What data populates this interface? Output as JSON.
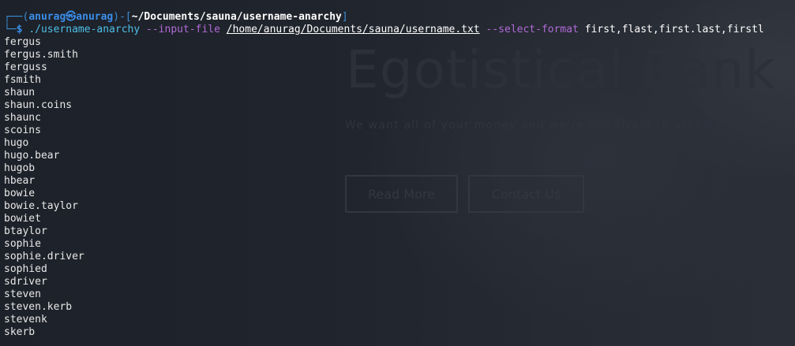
{
  "background": {
    "title": "Egotistical Bank",
    "subtitle": "We want all of your money and we're not afraid to ask!",
    "read_more": "Read More",
    "contact_us": "Contact Us"
  },
  "prompt": {
    "frame_top": "┌──(",
    "user": "anurag",
    "at_symbol": "㉿",
    "host": "anurag",
    "frame_mid": ")-[",
    "path": "~/Documents/sauna/username-anarchy",
    "frame_end": "]",
    "frame_bottom": "└─",
    "dollar": "$"
  },
  "command": {
    "executable": "./username-anarchy",
    "flag_input": "--input-file",
    "input_path": "/home/anurag/Documents/sauna/username.txt",
    "flag_format": "--select-format",
    "format_value": "first,flast,first.last,firstl"
  },
  "output_lines": [
    "fergus",
    "fergus.smith",
    "ferguss",
    "fsmith",
    "shaun",
    "shaun.coins",
    "shaunc",
    "scoins",
    "hugo",
    "hugo.bear",
    "hugob",
    "hbear",
    "bowie",
    "bowie.taylor",
    "bowiet",
    "btaylor",
    "sophie",
    "sophie.driver",
    "sophied",
    "sdriver",
    "steven",
    "steven.kerb",
    "stevenk",
    "skerb"
  ],
  "colors": {
    "terminal_bg": "#1e222a",
    "prompt_blue": "#3b8eea",
    "command_cyan": "#4dc0e8",
    "flag_purple": "#b06bd8"
  }
}
